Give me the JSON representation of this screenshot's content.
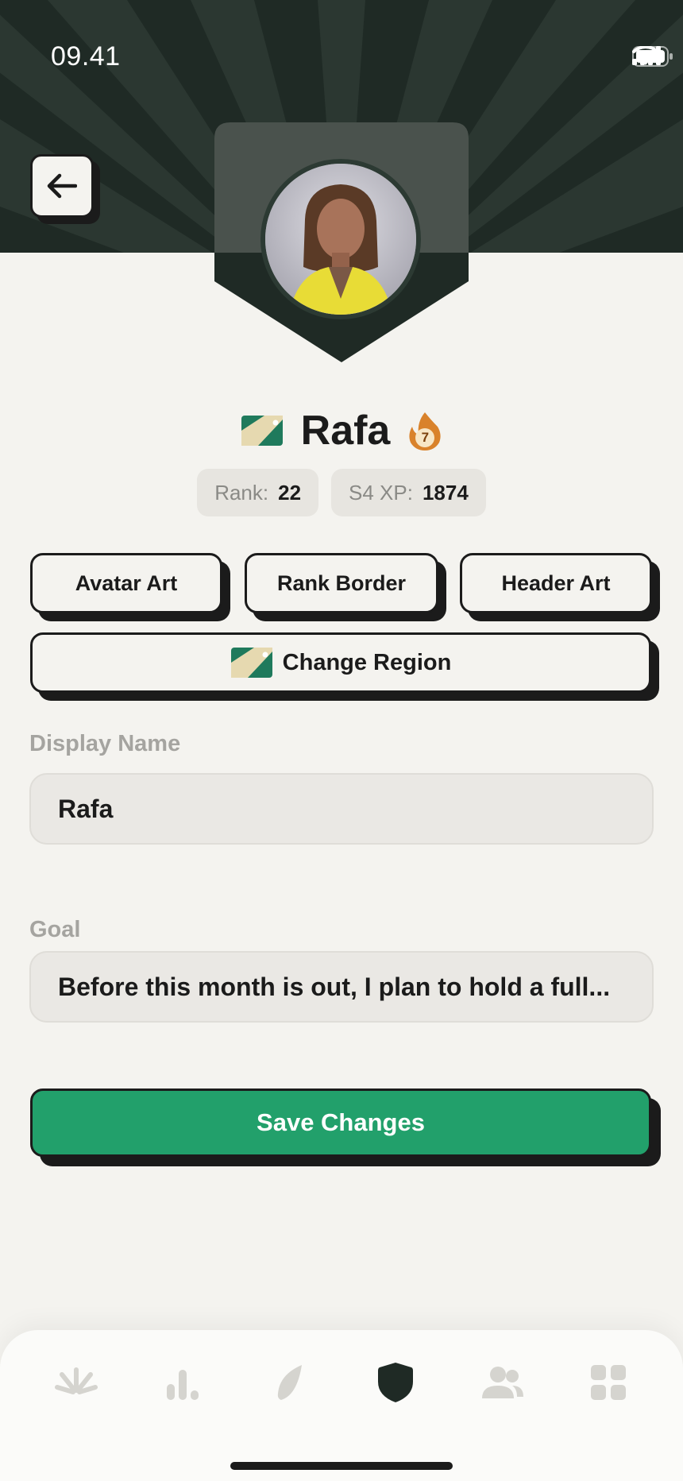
{
  "status": {
    "time": "09.41"
  },
  "profile": {
    "name": "Rafa",
    "streak_count": "7",
    "rank_label": "Rank:",
    "rank_value": "22",
    "xp_label": "S4 XP:",
    "xp_value": "1874"
  },
  "actions": {
    "avatar_art": "Avatar Art",
    "rank_border": "Rank Border",
    "header_art": "Header Art",
    "change_region": "Change Region"
  },
  "form": {
    "display_name_label": "Display Name",
    "display_name_value": "Rafa",
    "goal_label": "Goal",
    "goal_value": "Before this month is out, I plan to hold a full..."
  },
  "save_label": "Save Changes",
  "tabs": [
    {
      "icon": "burst-icon",
      "active": false
    },
    {
      "icon": "bar-chart-icon",
      "active": false
    },
    {
      "icon": "leaf-icon",
      "active": false
    },
    {
      "icon": "shield-icon",
      "active": true
    },
    {
      "icon": "people-icon",
      "active": false
    },
    {
      "icon": "grid-icon",
      "active": false
    }
  ],
  "colors": {
    "accent": "#22a06b",
    "header": "#1f2a25",
    "background": "#f4f3ef",
    "text": "#1b1b1b",
    "streak": "#d9822b"
  }
}
